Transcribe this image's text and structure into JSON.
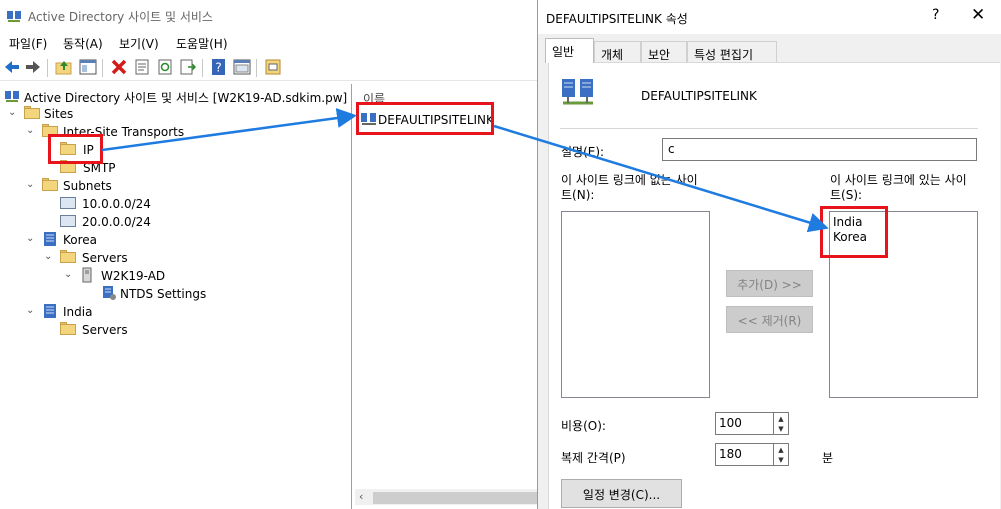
{
  "main_window": {
    "title": "Active Directory 사이트 및 서비스",
    "menu": [
      "파일(F)",
      "동작(A)",
      "보기(V)",
      "도움말(H)"
    ]
  },
  "tree": {
    "root": "Active Directory 사이트 및 서비스 [W2K19-AD.sdkim.pw]",
    "sites": "Sites",
    "inter_site_transports": "Inter-Site Transports",
    "ip": "IP",
    "smtp": "SMTP",
    "subnets": "Subnets",
    "subnet1": "10.0.0.0/24",
    "subnet2": "20.0.0.0/24",
    "korea": "Korea",
    "korea_servers": "Servers",
    "server": "W2K19-AD",
    "ntds": "NTDS Settings",
    "india": "India",
    "india_servers": "Servers"
  },
  "list": {
    "header": "이름",
    "item": "DEFAULTIPSITELINK"
  },
  "dialog": {
    "title": "DEFAULTIPSITELINK 속성",
    "help": "?",
    "close": "✕",
    "tabs": [
      "일반",
      "개체",
      "보안",
      "특성 편집기"
    ],
    "object_name": "DEFAULTIPSITELINK",
    "description_label": "설명(E):",
    "description_value": "c",
    "not_in_label_1": "이 사이트 링크에 없는 사이",
    "not_in_label_2": "트(N):",
    "in_label_1": "이 사이트 링크에 있는 사이",
    "in_label_2": "트(S):",
    "sites_in_link": [
      "India",
      "Korea"
    ],
    "add_button": "추가(D) >>",
    "remove_button": "<< 제거(R)",
    "cost_label": "비용(O):",
    "cost_value": "100",
    "interval_label": "복제 간격(P)",
    "interval_value": "180",
    "interval_unit": "분",
    "schedule_button": "일정 변경(C)..."
  },
  "colors": {
    "highlight": "#e8141c",
    "arrow": "#1e7be0"
  }
}
